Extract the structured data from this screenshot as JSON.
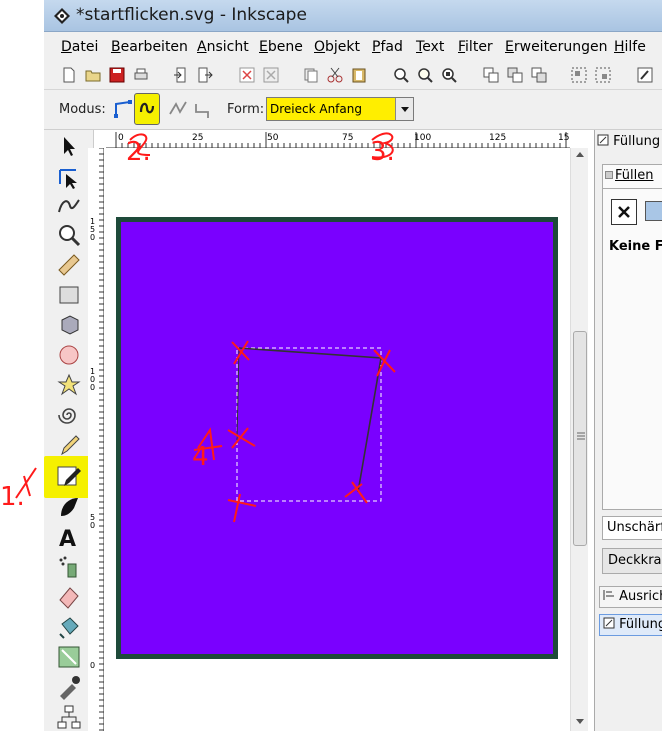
{
  "window": {
    "title": "*startflicken.svg - Inkscape"
  },
  "menu": [
    "Datei",
    "Bearbeiten",
    "Ansicht",
    "Ebene",
    "Objekt",
    "Pfad",
    "Text",
    "Filter",
    "Erweiterungen",
    "Hilfe"
  ],
  "toolcontrols": {
    "modus_label": "Modus:",
    "form_label": "Form:",
    "shape_value": "Dreieck Anfang"
  },
  "ruler": {
    "h_ticks": [
      "0",
      "25",
      "50",
      "75",
      "100",
      "125",
      "15"
    ],
    "v_ticks": [
      "150",
      "100",
      "50",
      "0"
    ]
  },
  "panel": {
    "tab_label": "Füllung",
    "fill_tab": "Füllen",
    "none_text": "Keine Fa",
    "blur_label": "Unschärf",
    "opacity_label": "Deckkra",
    "dock_align": "Ausrich",
    "dock_fill": "Füllung"
  },
  "annotations": [
    "1.",
    "2.",
    "3.",
    "4"
  ],
  "colors": {
    "page_fill": "#7a00ff",
    "page_border": "#1e4a3a",
    "highlight": "#f5f000",
    "annotation": "#ff0000"
  }
}
